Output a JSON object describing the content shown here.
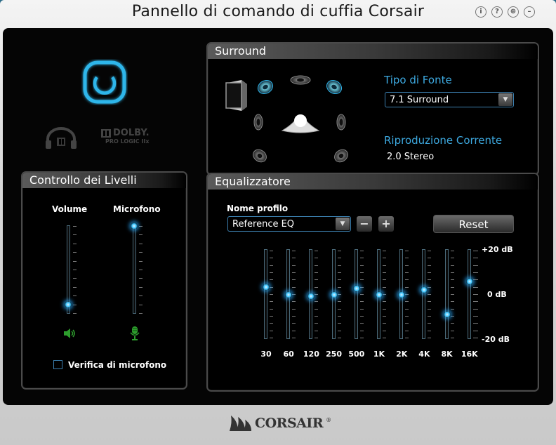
{
  "window": {
    "title": "Pannello di comando di cuffia Corsair"
  },
  "title_icons": [
    "info-icon",
    "help-icon",
    "globe-icon",
    "minimize-icon"
  ],
  "top_left": {
    "power_icon": "power-icon",
    "dolby_headphone": "dolby-headphone-icon",
    "dolby_pl_line1": "DOLBY.",
    "dolby_pl_line2": "PRO LOGIC IIx"
  },
  "levels": {
    "header": "Controllo dei Livelli",
    "volume_label": "Volume",
    "mic_label": "Microfono",
    "volume_level": 0.1,
    "mic_level": 1.0,
    "verify_label": "Verifica di microfono",
    "verify_checked": false
  },
  "surround": {
    "header": "Surround",
    "source_label": "Tipo di Fonte",
    "source_value": "7.1 Surround",
    "playback_label": "Riproduzione Corrente",
    "playback_value": "2.0 Stereo"
  },
  "equalizer": {
    "header": "Equalizzatore",
    "profile_label": "Nome profilo",
    "profile_value": "Reference EQ",
    "minus": "−",
    "plus": "+",
    "reset": "Reset",
    "db_top": "+20 dB",
    "db_mid": "0 dB",
    "db_bot": "-20 dB",
    "bands": [
      {
        "freq": "30",
        "level": 0.15
      },
      {
        "freq": "60",
        "level": -0.02
      },
      {
        "freq": "120",
        "level": -0.05
      },
      {
        "freq": "250",
        "level": -0.02
      },
      {
        "freq": "500",
        "level": 0.13
      },
      {
        "freq": "1K",
        "level": -0.02
      },
      {
        "freq": "2K",
        "level": -0.02
      },
      {
        "freq": "4K",
        "level": 0.1
      },
      {
        "freq": "8K",
        "level": -0.45
      },
      {
        "freq": "16K",
        "level": 0.28
      }
    ]
  },
  "brand": {
    "logo": "CORSAIR"
  }
}
